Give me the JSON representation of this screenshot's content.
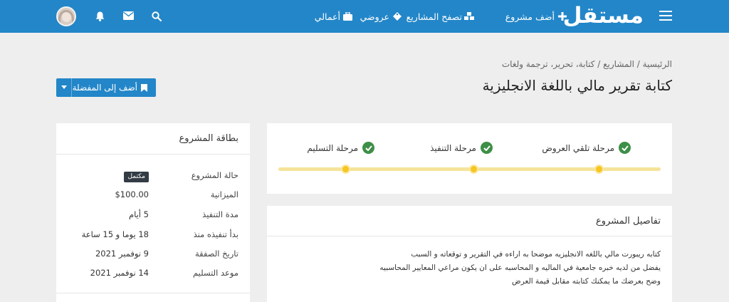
{
  "header": {
    "logo": "مستقل",
    "nav": [
      {
        "label": "أضف مشروع",
        "icon": "plus-icon"
      },
      {
        "label": "تصفح المشاريع",
        "icon": "cubes-icon"
      },
      {
        "label": "عروضي",
        "icon": "tag-icon"
      },
      {
        "label": "أعمالي",
        "icon": "briefcase-icon"
      }
    ],
    "icons": [
      "search-icon",
      "envelope-icon",
      "bell-icon",
      "avatar"
    ]
  },
  "breadcrumb": {
    "home": "الرئيسية",
    "projects": "المشاريع",
    "category": "كتابة، تحرير، ترجمة ولغات",
    "separator": "/"
  },
  "page": {
    "title": "كتابة تقرير مالي باللغة الانجليزية",
    "favorite_label": "أضف إلى المفضلة"
  },
  "stages": {
    "items": [
      {
        "label": "مرحلة تلقي العروض",
        "done": true
      },
      {
        "label": "مرحلة التنفيذ",
        "done": true
      },
      {
        "label": "مرحلة التسليم",
        "done": true
      }
    ]
  },
  "details": {
    "title": "تفاصيل المشروع",
    "lines": [
      "كتابه ريبورت مالي باللغه الانجليزيه موضحا به اراءه في التقرير و توقعاته و السبب",
      "يفضل من لديه خبره جامعية في الماليه و المحاسبه على ان يكون مراعي المعايير المحاسبيه",
      "وضح بعرضك ما يمكنك كتابته مقابل قيمة العرض"
    ]
  },
  "project_card": {
    "title": "بطاقة المشروع",
    "rows": [
      {
        "key": "حالة المشروع",
        "value": "مكتمل",
        "badge": true
      },
      {
        "key": "الميزانية",
        "value": "$100.00"
      },
      {
        "key": "مدة التنفيذ",
        "value": "5 أيام"
      },
      {
        "key": "بدأ تنفيذه منذ",
        "value": "18 يوما و 15 ساعة"
      },
      {
        "key": "تاريخ الصفقة",
        "value": "9 نوفمبر 2021"
      },
      {
        "key": "موعد التسليم",
        "value": "14 نوفمبر 2021"
      }
    ]
  },
  "colors": {
    "primary": "#2386c8",
    "success": "#3d8f47",
    "progress_track": "#f5e39a",
    "progress_dot": "#f6c621",
    "badge": "#333b44"
  }
}
